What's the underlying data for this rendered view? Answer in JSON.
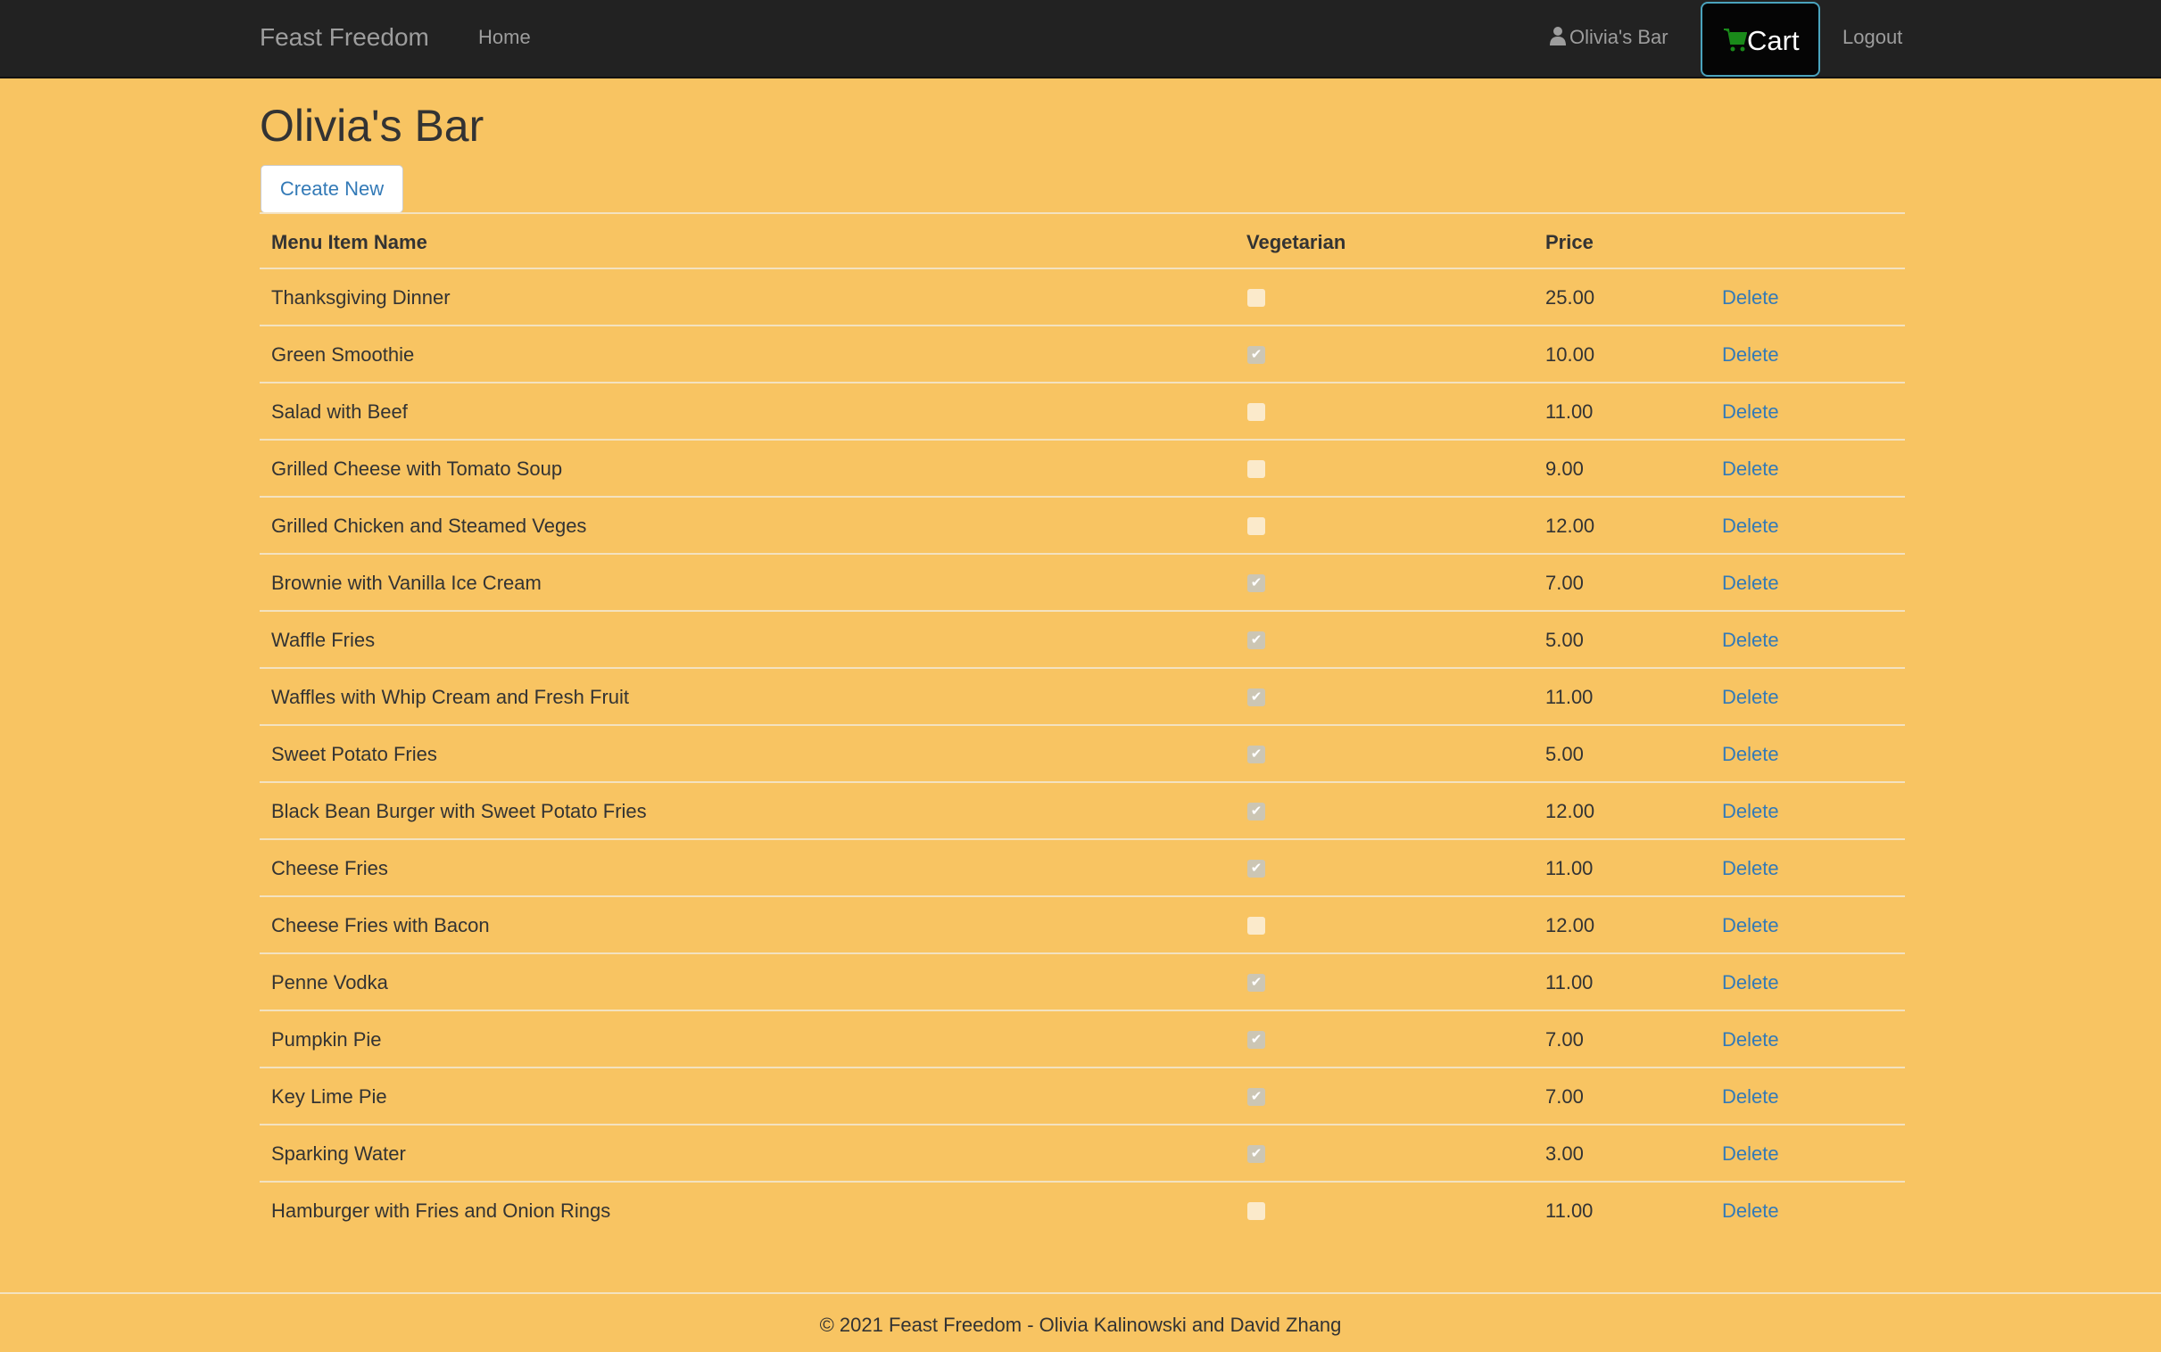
{
  "nav": {
    "brand": "Feast Freedom",
    "home": "Home",
    "user": "Olivia's Bar",
    "cart": "Cart",
    "logout": "Logout"
  },
  "page": {
    "title": "Olivia's Bar",
    "create": "Create New"
  },
  "table": {
    "headers": [
      "Menu Item Name",
      "Vegetarian",
      "Price"
    ],
    "delete_label": "Delete",
    "rows": [
      {
        "name": "Thanksgiving Dinner",
        "vegetarian": false,
        "price": "25.00"
      },
      {
        "name": "Green Smoothie",
        "vegetarian": true,
        "price": "10.00"
      },
      {
        "name": "Salad with Beef",
        "vegetarian": false,
        "price": "11.00"
      },
      {
        "name": "Grilled Cheese with Tomato Soup",
        "vegetarian": false,
        "price": "9.00"
      },
      {
        "name": "Grilled Chicken and Steamed Veges",
        "vegetarian": false,
        "price": "12.00"
      },
      {
        "name": "Brownie with Vanilla Ice Cream",
        "vegetarian": true,
        "price": "7.00"
      },
      {
        "name": "Waffle Fries",
        "vegetarian": true,
        "price": "5.00"
      },
      {
        "name": "Waffles with Whip Cream and Fresh Fruit",
        "vegetarian": true,
        "price": "11.00"
      },
      {
        "name": "Sweet Potato Fries",
        "vegetarian": true,
        "price": "5.00"
      },
      {
        "name": "Black Bean Burger with Sweet Potato Fries",
        "vegetarian": true,
        "price": "12.00"
      },
      {
        "name": "Cheese Fries",
        "vegetarian": true,
        "price": "11.00"
      },
      {
        "name": "Cheese Fries with Bacon",
        "vegetarian": false,
        "price": "12.00"
      },
      {
        "name": "Penne Vodka",
        "vegetarian": true,
        "price": "11.00"
      },
      {
        "name": "Pumpkin Pie",
        "vegetarian": true,
        "price": "7.00"
      },
      {
        "name": "Key Lime Pie",
        "vegetarian": true,
        "price": "7.00"
      },
      {
        "name": "Sparking Water",
        "vegetarian": true,
        "price": "3.00"
      },
      {
        "name": "Hamburger with Fries and Onion Rings",
        "vegetarian": false,
        "price": "11.00"
      }
    ]
  },
  "footer": "© 2021 Feast Freedom - Olivia Kalinowski and David Zhang",
  "colors": {
    "background": "#f8c462",
    "navbar": "#222222",
    "link": "#337ab7",
    "cart_icon": "#1a8a1a"
  }
}
